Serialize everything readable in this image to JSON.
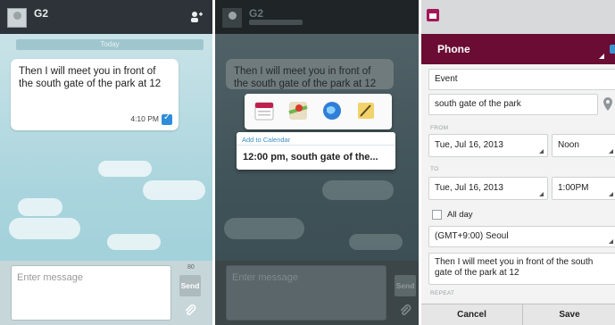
{
  "conversation": {
    "contact_name": "G2",
    "date_label": "Today",
    "message_text": "Then I will meet you in front of the south gate of the park at 12",
    "message_time": "4:10 PM",
    "compose_placeholder": "Enter message",
    "char_count": "80",
    "send_label": "Send"
  },
  "share_popup": {
    "apps": [
      "calendar-icon",
      "maps-icon",
      "browser-icon",
      "memo-icon"
    ],
    "title": "Add to Calendar",
    "value": "12:00 pm, south gate of the..."
  },
  "event_form": {
    "account": "Phone",
    "title_value": "Event",
    "location_value": "south gate of the park",
    "from_label": "FROM",
    "from_date": "Tue, Jul 16, 2013",
    "from_time": "Noon",
    "to_label": "TO",
    "to_date": "Tue, Jul 16, 2013",
    "to_time": "1:00PM",
    "all_day_label": "All day",
    "timezone": "(GMT+9:00) Seoul",
    "description": "Then I will meet you in front of the south gate of the park at 12",
    "repeat_label": "REPEAT",
    "cancel_label": "Cancel",
    "save_label": "Save"
  },
  "colors": {
    "accent_dark": "#6a0c33",
    "chat_bg": "#a9d4dd",
    "link_blue": "#3a8fc7"
  }
}
